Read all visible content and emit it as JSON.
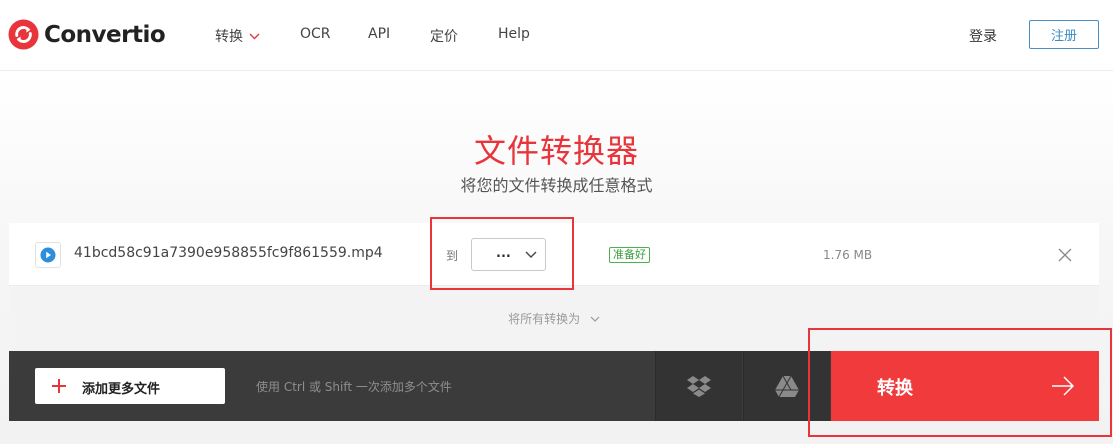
{
  "header": {
    "logo_text": "Convertio",
    "nav": [
      {
        "label": "转换",
        "has_dropdown": true
      },
      {
        "label": "OCR"
      },
      {
        "label": "API"
      },
      {
        "label": "定价"
      },
      {
        "label": "Help"
      }
    ],
    "login_label": "登录",
    "register_label": "注册"
  },
  "hero": {
    "title": "文件转换器",
    "subtitle": "将您的文件转换成任意格式"
  },
  "file": {
    "name": "41bcd58c91a7390e958855fc9f861559.mp4",
    "to_label": "到",
    "format_value": "...",
    "status": "准备好",
    "size": "1.76 MB",
    "icon": "play-icon"
  },
  "convert_all_label": "将所有转换为",
  "bottom": {
    "add_label": "添加更多文件",
    "hint": "使用 Ctrl 或 Shift 一次添加多个文件",
    "convert_label": "转换"
  },
  "colors": {
    "accent": "#f03a3c",
    "brand_red": "#e8353b",
    "ready_green": "#4caf50",
    "bar_dark": "#3b3b3b"
  }
}
